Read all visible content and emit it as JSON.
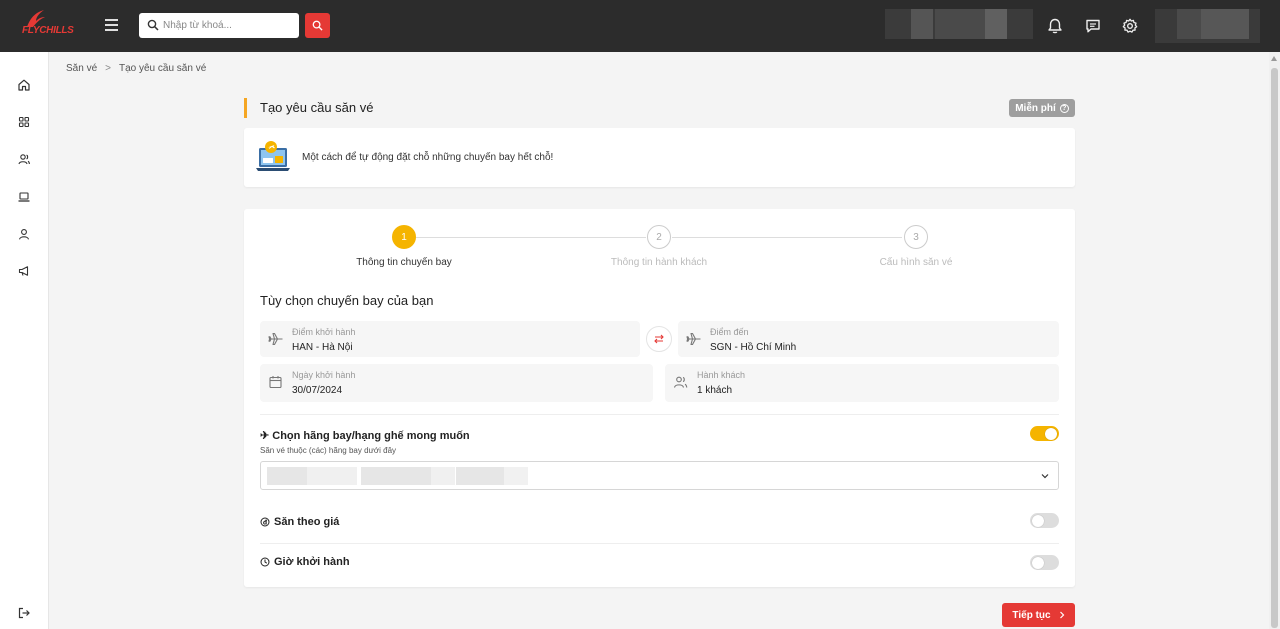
{
  "app": {
    "brand": "FLYCHILLS"
  },
  "header": {
    "search": {
      "placeholder": "Nhập từ khoá..."
    }
  },
  "breadcrumb": [
    "Săn vé",
    "Tạo yêu cầu săn vé"
  ],
  "page": {
    "title": "Tạo yêu cầu săn vé",
    "badge": "Miễn phí",
    "badge_help": "?",
    "info": "Một cách để tự động đặt chỗ những chuyến bay hết chỗ!"
  },
  "steps": [
    {
      "number": "1",
      "label": "Thông tin chuyến bay",
      "active": true
    },
    {
      "number": "2",
      "label": "Thông tin hành khách",
      "active": false
    },
    {
      "number": "3",
      "label": "Cấu hình săn vé",
      "active": false
    }
  ],
  "form": {
    "section_title": "Tùy chọn chuyến bay của bạn",
    "origin": {
      "label": "Điểm khởi hành",
      "value": "HAN - Hà Nội"
    },
    "destination": {
      "label": "Điểm đến",
      "value": "SGN - Hồ Chí Minh"
    },
    "date": {
      "label": "Ngày khởi hành",
      "value": "30/07/2024"
    },
    "passengers": {
      "label": "Hành khách",
      "value": "1 khách"
    },
    "airline": {
      "title": "✈ Chọn hãng bay/hạng ghế mong muốn",
      "subtitle": "Săn vé thuộc (các) hãng bay dưới đây",
      "enabled": true
    },
    "price_hunt": {
      "label": "Săn theo giá",
      "enabled": false
    },
    "departure_time": {
      "label": "Giờ khởi hành",
      "enabled": false
    }
  },
  "actions": {
    "next": "Tiếp tục"
  },
  "colors": {
    "accent": "#f5b400",
    "primary": "#e53935",
    "topbar": "#2c2c2c"
  }
}
